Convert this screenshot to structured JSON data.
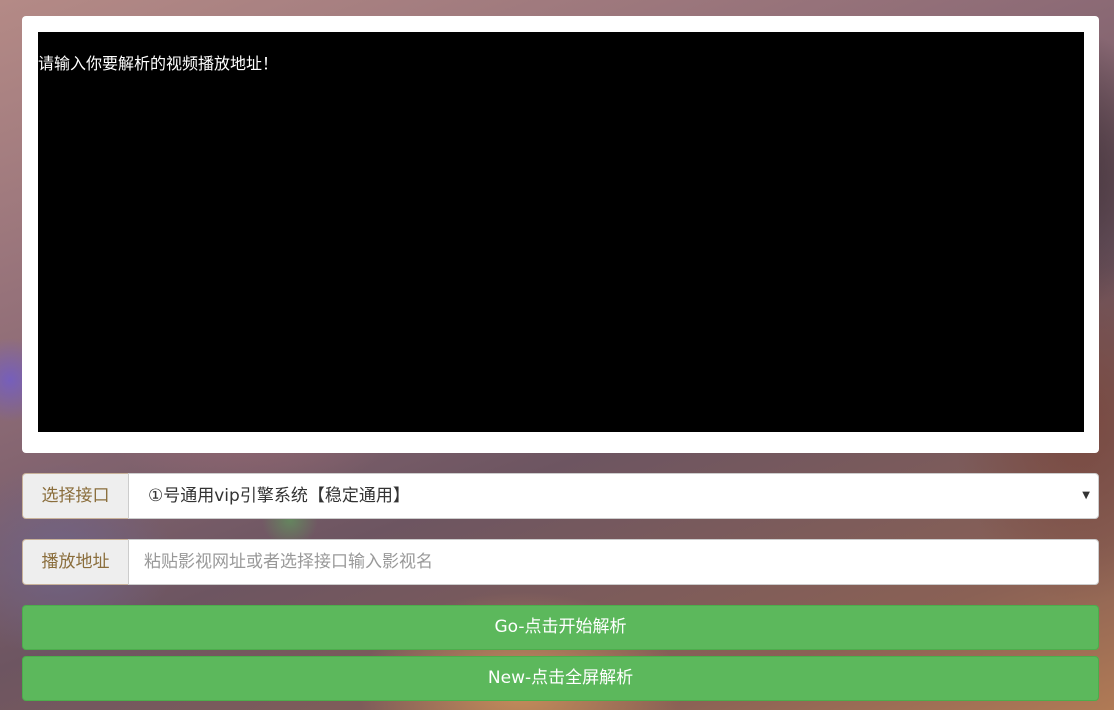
{
  "player": {
    "message": "请输入你要解析的视频播放地址！"
  },
  "interface_select": {
    "label": "选择接口",
    "selected_value": "①号通用vip引擎系统【稳定通用】"
  },
  "url_input": {
    "label": "播放地址",
    "placeholder": "粘贴影视网址或者选择接口输入影视名",
    "value": ""
  },
  "buttons": {
    "go_label": "Go-点击开始解析",
    "new_label": "New-点击全屏解析"
  },
  "colors": {
    "button_green": "#5cb85c",
    "addon_text": "#8a6d3b",
    "player_background": "#000000"
  },
  "icons": {
    "select_arrow": "dropdown-arrow-icon"
  }
}
